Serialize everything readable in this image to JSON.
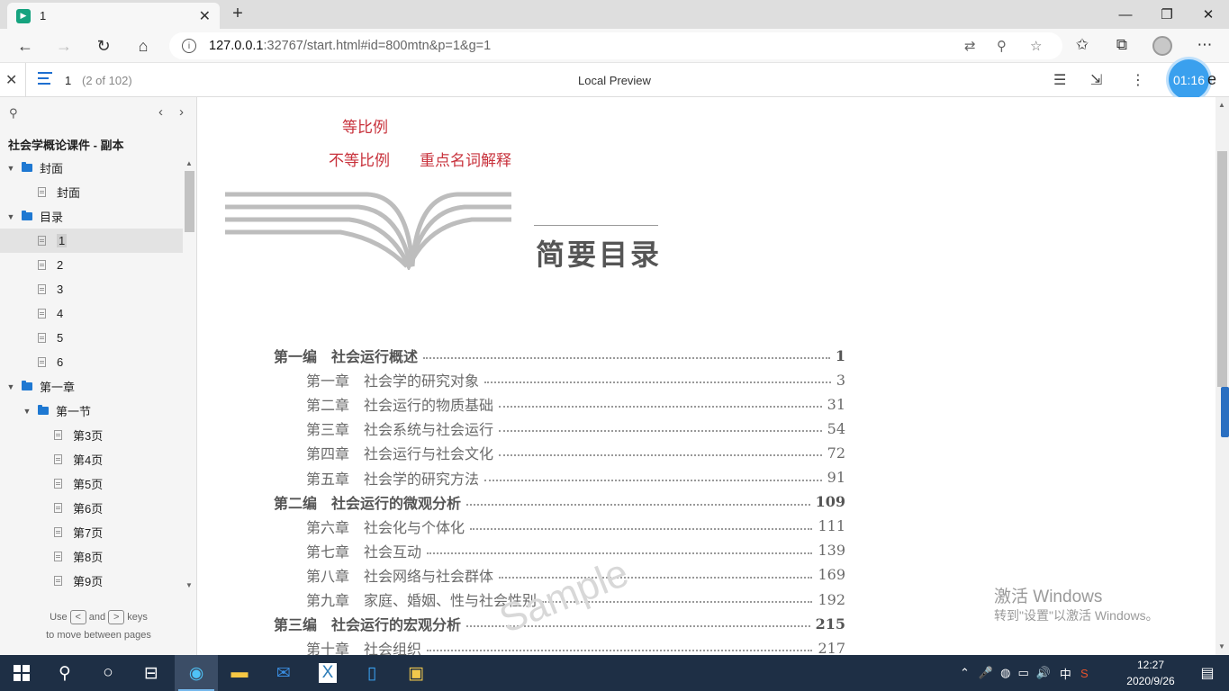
{
  "browser": {
    "tab_title": "1",
    "tab_favicon_letter": "▶",
    "url_host": "127.0.0.1",
    "url_rest": ":32767/start.html#id=800mtn&p=1&g=1"
  },
  "viewer": {
    "current_page": "1",
    "page_count": "(2 of 102)",
    "title": "Local Preview",
    "timer": "01:16",
    "timer_suffix": "e"
  },
  "sidebar": {
    "doc_title": "社会学概论课件 - 副本",
    "hint_use": "Use",
    "hint_and": "and",
    "hint_keys": "keys",
    "hint_line2": "to move between pages",
    "key_prev": "<",
    "key_next": ">",
    "tree": [
      {
        "label": "封面",
        "type": "folder",
        "level": 0
      },
      {
        "label": "封面",
        "type": "page",
        "level": 1
      },
      {
        "label": "目录",
        "type": "folder",
        "level": 0
      },
      {
        "label": "1",
        "type": "page",
        "level": 1,
        "selected": true
      },
      {
        "label": "2",
        "type": "page",
        "level": 1
      },
      {
        "label": "3",
        "type": "page",
        "level": 1
      },
      {
        "label": "4",
        "type": "page",
        "level": 1
      },
      {
        "label": "5",
        "type": "page",
        "level": 1
      },
      {
        "label": "6",
        "type": "page",
        "level": 1
      },
      {
        "label": "第一章",
        "type": "folder",
        "level": 0
      },
      {
        "label": "第一节",
        "type": "folder",
        "level": 1
      },
      {
        "label": "第3页",
        "type": "page",
        "level": 2
      },
      {
        "label": "第4页",
        "type": "page",
        "level": 2
      },
      {
        "label": "第5页",
        "type": "page",
        "level": 2
      },
      {
        "label": "第6页",
        "type": "page",
        "level": 2
      },
      {
        "label": "第7页",
        "type": "page",
        "level": 2
      },
      {
        "label": "第8页",
        "type": "page",
        "level": 2
      },
      {
        "label": "第9页",
        "type": "page",
        "level": 2
      }
    ]
  },
  "page": {
    "link1": "等比例",
    "link2": "不等比例",
    "link3": "重点名词解释",
    "heading": "简要目录",
    "toc": [
      {
        "text": "第一编　社会运行概述",
        "num": "1",
        "part": true
      },
      {
        "text": "第一章　社会学的研究对象",
        "num": "3",
        "part": false
      },
      {
        "text": "第二章　社会运行的物质基础",
        "num": "31",
        "part": false
      },
      {
        "text": "第三章　社会系统与社会运行",
        "num": "54",
        "part": false
      },
      {
        "text": "第四章　社会运行与社会文化",
        "num": "72",
        "part": false
      },
      {
        "text": "第五章　社会学的研究方法",
        "num": "91",
        "part": false
      },
      {
        "text": "第二编　社会运行的微观分析",
        "num": "109",
        "part": true
      },
      {
        "text": "第六章　社会化与个体化",
        "num": "111",
        "part": false
      },
      {
        "text": "第七章　社会互动",
        "num": "139",
        "part": false
      },
      {
        "text": "第八章　社会网络与社会群体",
        "num": "169",
        "part": false
      },
      {
        "text": "第九章　家庭、婚姻、性与社会性别",
        "num": "192",
        "part": false
      },
      {
        "text": "第三编　社会运行的宏观分析",
        "num": "215",
        "part": true
      },
      {
        "text": "第十章　社会组织",
        "num": "217",
        "part": false
      }
    ],
    "sample": "Sample",
    "activate1": "激活 Windows",
    "activate2": "转到\"设置\"以激活 Windows。"
  },
  "taskbar": {
    "time": "12:27",
    "date": "2020/9/26",
    "ime": "中"
  }
}
